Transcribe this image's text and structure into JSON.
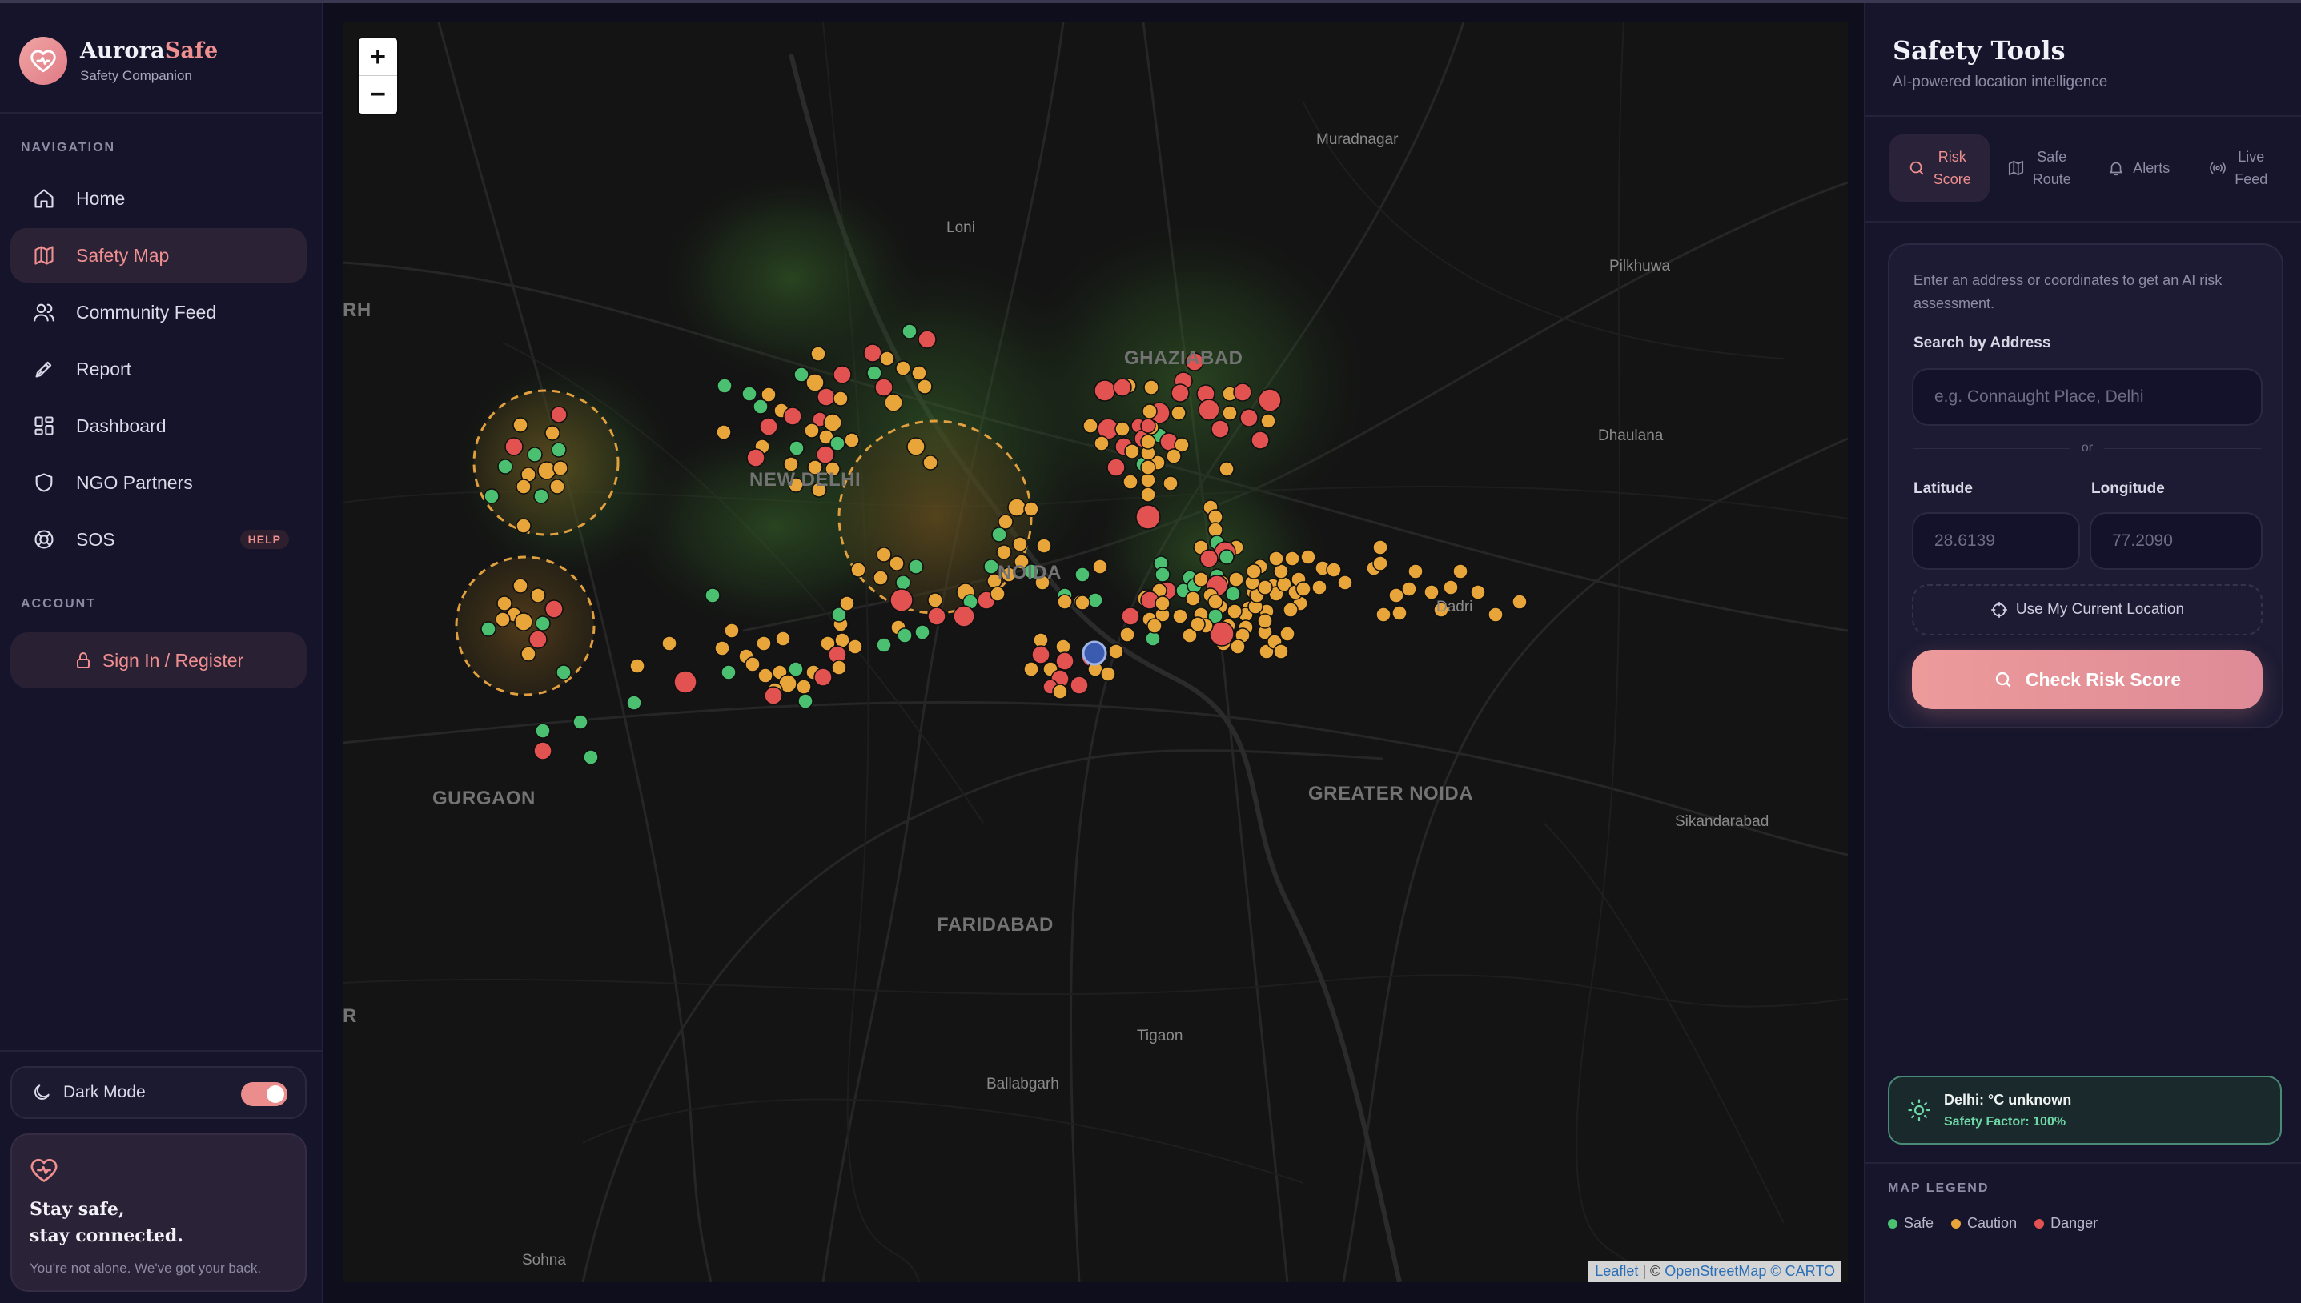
{
  "brand": {
    "name_main": "Aurora",
    "name_accent": "Safe",
    "subtitle": "Safety Companion"
  },
  "sidebar": {
    "nav_label": "NAVIGATION",
    "nav_items": [
      {
        "label": "Home",
        "icon": "home-icon"
      },
      {
        "label": "Safety Map",
        "icon": "map-icon",
        "active": true
      },
      {
        "label": "Community Feed",
        "icon": "users-icon"
      },
      {
        "label": "Report",
        "icon": "pen-icon"
      },
      {
        "label": "Dashboard",
        "icon": "dashboard-icon"
      },
      {
        "label": "NGO Partners",
        "icon": "shield-icon"
      },
      {
        "label": "SOS",
        "icon": "lifebuoy-icon",
        "badge": "HELP"
      }
    ],
    "account_label": "ACCOUNT",
    "signin_label": "Sign In / Register",
    "dark_mode_label": "Dark Mode",
    "dark_mode_on": true,
    "card": {
      "title_line1": "Stay safe,",
      "title_line2": "stay connected.",
      "subtitle": "You're not alone. We've got your back."
    }
  },
  "map": {
    "zoom_in": "+",
    "zoom_out": "−",
    "labels": {
      "muradnagar": "Muradnagar",
      "loni": "Loni",
      "pilkhuwa": "Pilkhuwa",
      "ghaziabad": "GHAZIABAD",
      "new_delhi": "NEW DELHI",
      "noida": "NOIDA",
      "dhaulana": "Dhaulana",
      "dadri": "Dadri",
      "gurgaon": "GURGAON",
      "greater_noida": "GREATER NOIDA",
      "sikandarabad": "Sikandarabad",
      "faridabad": "FARIDABAD",
      "tigaon": "Tigaon",
      "ballabgarh": "Ballabgarh",
      "sohna": "Sohna",
      "edge_rh": "RH",
      "edge_r": "R"
    },
    "attribution": {
      "leaflet": "Leaflet",
      "sep": " | © ",
      "osm": "OpenStreetMap",
      "carto": " © CARTO"
    },
    "colors": {
      "safe": "#4cc071",
      "caution": "#e8a63a",
      "danger": "#e25250"
    }
  },
  "panel": {
    "title": "Safety Tools",
    "subtitle": "AI-powered location intelligence",
    "tabs": [
      {
        "label_1": "Risk",
        "label_2": "Score",
        "icon": "search-icon",
        "active": true
      },
      {
        "label_1": "Safe",
        "label_2": "Route",
        "icon": "map-icon"
      },
      {
        "label_1": "Alerts",
        "label_2": "",
        "icon": "bell-icon"
      },
      {
        "label_1": "Live",
        "label_2": "Feed",
        "icon": "broadcast-icon"
      }
    ],
    "hint": "Enter an address or coordinates to get an AI risk assessment.",
    "search_label": "Search by Address",
    "search_placeholder": "e.g. Connaught Place, Delhi",
    "or_text": "or",
    "lat_label": "Latitude",
    "lat_placeholder": "28.6139",
    "lng_label": "Longitude",
    "lng_placeholder": "77.2090",
    "location_btn": "Use My Current Location",
    "check_btn": "Check Risk Score",
    "weather_title": "Delhi: °C unknown",
    "weather_sub": "Safety Factor: 100%",
    "legend_title": "MAP LEGEND",
    "legend": [
      {
        "label": "Safe",
        "color": "#4cc071"
      },
      {
        "label": "Caution",
        "color": "#e8a63a"
      },
      {
        "label": "Danger",
        "color": "#e25250"
      }
    ]
  }
}
